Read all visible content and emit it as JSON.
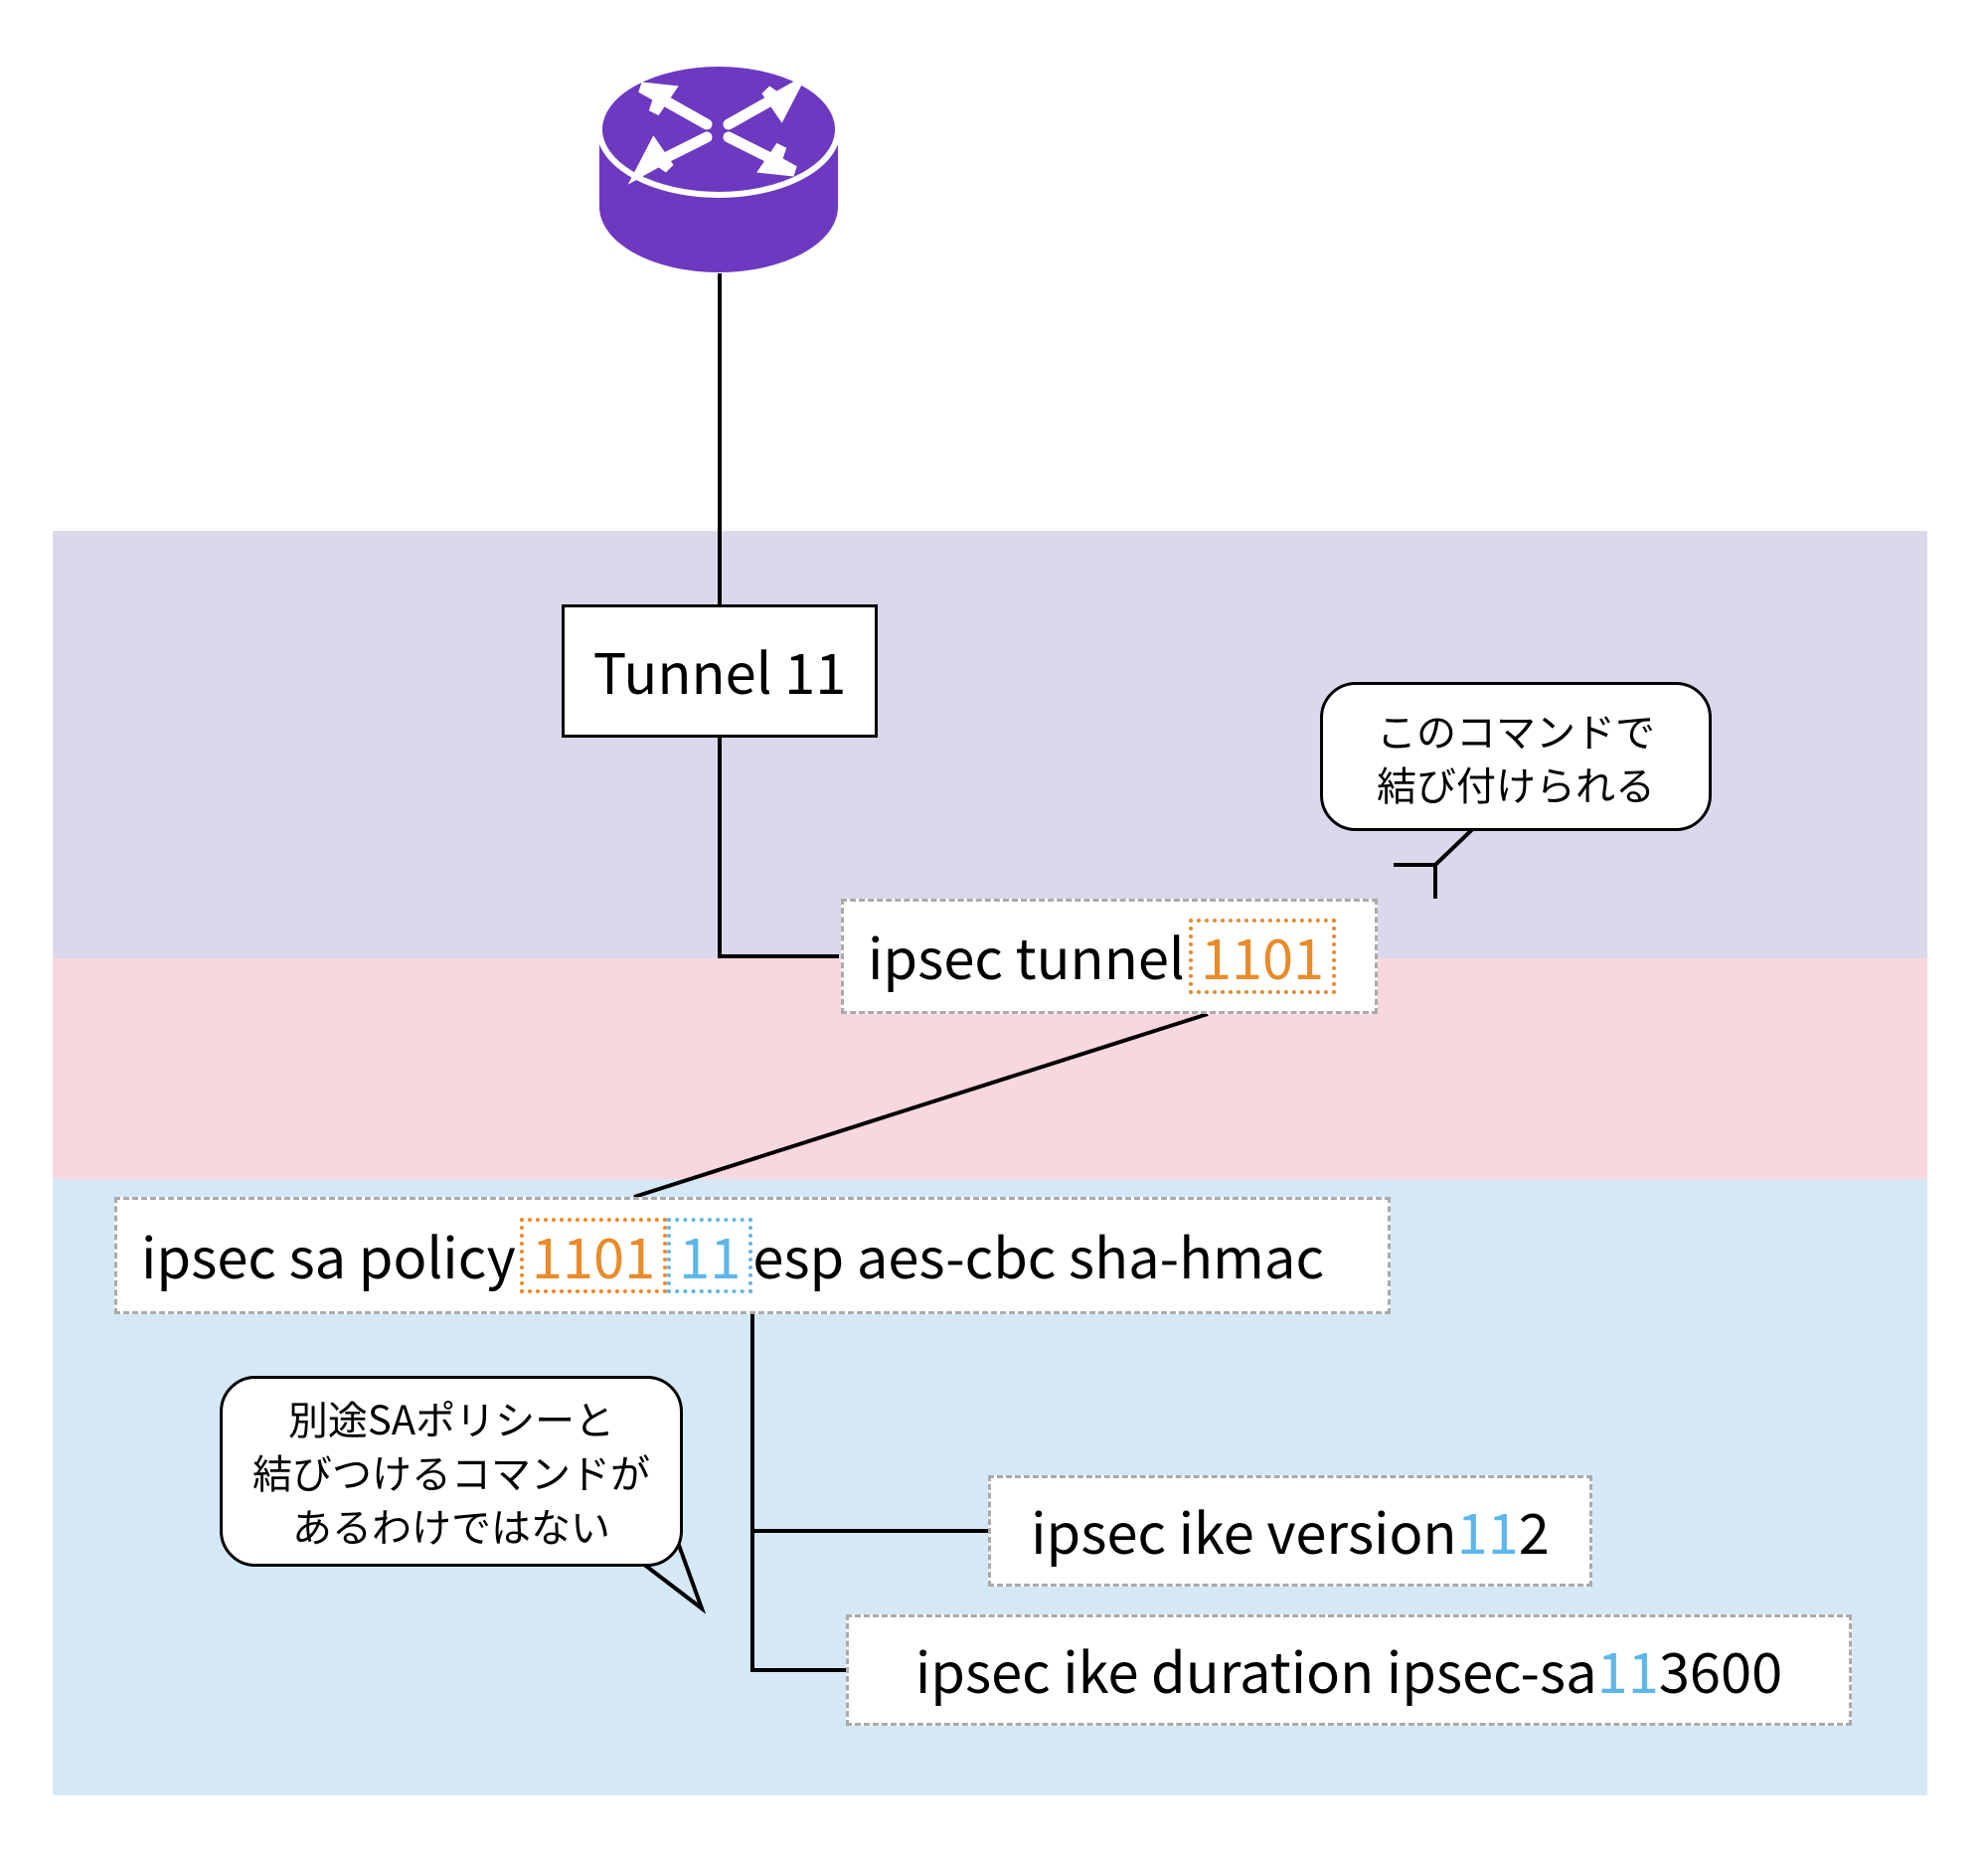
{
  "colors": {
    "band_purple": "#dcd8ec",
    "band_pink": "#f8d8de",
    "band_blue": "#d5e8f6",
    "accent_orange": "#e98b2a",
    "accent_blue": "#5db7ea",
    "router": "#6d39c0"
  },
  "nodes": {
    "tunnel": {
      "label": "Tunnel 11"
    },
    "ipsec_tunnel": {
      "prefix": "ipsec tunnel ",
      "num_orange": "1101"
    },
    "sa_policy": {
      "prefix": "ipsec sa policy ",
      "num_orange": "1101",
      "num_blue": "11",
      "suffix": " esp aes-cbc sha-hmac"
    },
    "ike_version": {
      "prefix": "ipsec ike version ",
      "num_blue": "11",
      "suffix": " 2"
    },
    "ike_duration": {
      "prefix": "ipsec ike duration ipsec-sa ",
      "num_blue": "11",
      "suffix": " 3600"
    }
  },
  "callouts": {
    "c1_line1": "このコマンドで",
    "c1_line2": "結び付けられる",
    "c2_line1": "別途SAポリシーと",
    "c2_line2": "結びつけるコマンドが",
    "c2_line3": "あるわけではない"
  }
}
